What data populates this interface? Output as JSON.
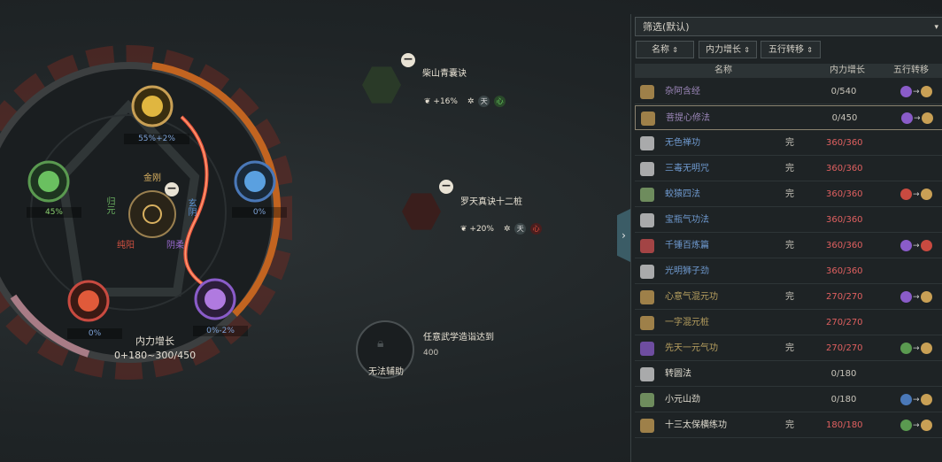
{
  "wheel": {
    "center_label": "金刚",
    "top_pct": "55%+2%",
    "left_pct": "45%",
    "right_pct": "0%",
    "bottom_left_pct": "0%",
    "bottom_right_pct": "0%-2%",
    "axis_labels": {
      "guiyuan": "归元",
      "xuanyin": "玄阴",
      "chunyang": "纯阳",
      "yinrou": "阴柔"
    },
    "power_title": "内力增长",
    "power_value": "0+180~300/450"
  },
  "skills": [
    {
      "name": "柴山青囊诀",
      "stat": "+16%",
      "badge_a": "天",
      "badge_b": "心"
    },
    {
      "name": "罗天真诀十二桩",
      "stat": "+20%",
      "badge_a": "天",
      "badge_b": "心"
    },
    {
      "name": "任意武学造诣达到",
      "value": "400",
      "slot_text": "无法辅助"
    }
  ],
  "panel": {
    "filter_label": "筛选(默认)",
    "sort_buttons": [
      "名称",
      "内力增长",
      "五行转移"
    ],
    "headers": [
      "名称",
      "内力增长",
      "五行转移"
    ],
    "done_label": "完",
    "rows": [
      {
        "name": "杂阿含经",
        "value": "0/540",
        "done": false,
        "name_color": "#9b86b8",
        "val_color": "#c8c4ba",
        "icon": "#c9a055",
        "conv": [
          "#8a5cc9",
          "#c9a055"
        ]
      },
      {
        "name": "菩提心修法",
        "value": "0/450",
        "done": false,
        "name_color": "#9b86b8",
        "val_color": "#c8c4ba",
        "icon": "#c9a055",
        "conv": [
          "#8a5cc9",
          "#c9a055"
        ],
        "selected": true
      },
      {
        "name": "无色禅功",
        "value": "360/360",
        "done": true,
        "name_color": "#6f9ad0",
        "val_color": "#e06060",
        "icon": "#d8d8d8",
        "conv": []
      },
      {
        "name": "三毒无明咒",
        "value": "360/360",
        "done": true,
        "name_color": "#6f9ad0",
        "val_color": "#e06060",
        "icon": "#d8d8d8",
        "conv": []
      },
      {
        "name": "蛟猿四法",
        "value": "360/360",
        "done": true,
        "name_color": "#6f9ad0",
        "val_color": "#e06060",
        "icon": "#8ab070",
        "conv": [
          "#c94a40",
          "#c9a055"
        ]
      },
      {
        "name": "宝瓶气功法",
        "value": "360/360",
        "done": false,
        "name_color": "#6f9ad0",
        "val_color": "#e06060",
        "icon": "#d8d8d8",
        "conv": []
      },
      {
        "name": "千锤百炼篇",
        "value": "360/360",
        "done": true,
        "name_color": "#6f9ad0",
        "val_color": "#e06060",
        "icon": "#d05050",
        "conv": [
          "#8a5cc9",
          "#c94a40"
        ]
      },
      {
        "name": "光明狮子劲",
        "value": "360/360",
        "done": false,
        "name_color": "#6f9ad0",
        "val_color": "#e06060",
        "icon": "#d8d8d8",
        "conv": []
      },
      {
        "name": "心意气混元功",
        "value": "270/270",
        "done": true,
        "name_color": "#b8a060",
        "val_color": "#e06060",
        "icon": "#c9a055",
        "conv": [
          "#8a5cc9",
          "#c9a055"
        ]
      },
      {
        "name": "一字混元桩",
        "value": "270/270",
        "done": false,
        "name_color": "#b8a060",
        "val_color": "#e06060",
        "icon": "#c9a055",
        "conv": []
      },
      {
        "name": "先天一元气功",
        "value": "270/270",
        "done": true,
        "name_color": "#b8a060",
        "val_color": "#e06060",
        "icon": "#8a5cc9",
        "conv": [
          "#5a9a50",
          "#c9a055"
        ]
      },
      {
        "name": "转圆法",
        "value": "0/180",
        "done": false,
        "name_color": "#e0dcd0",
        "val_color": "#c8c4ba",
        "icon": "#d8d8d8",
        "conv": []
      },
      {
        "name": "小元山劲",
        "value": "0/180",
        "done": false,
        "name_color": "#e0dcd0",
        "val_color": "#c8c4ba",
        "icon": "#8ab070",
        "conv": [
          "#4a78b8",
          "#c9a055"
        ]
      },
      {
        "name": "十三太保横练功",
        "value": "180/180",
        "done": true,
        "name_color": "#e0dcd0",
        "val_color": "#e06060",
        "icon": "#c9a055",
        "conv": [
          "#5a9a50",
          "#c9a055"
        ]
      }
    ]
  }
}
